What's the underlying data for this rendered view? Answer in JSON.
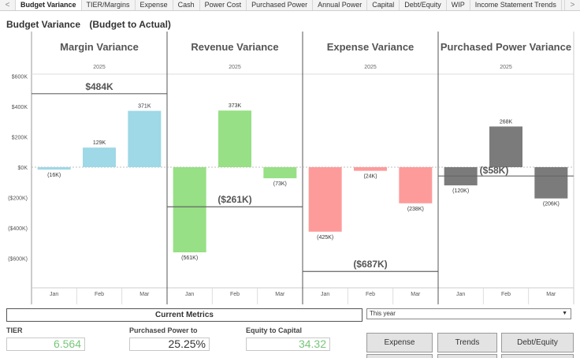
{
  "tabs": [
    "Budget Variance",
    "TIER/Margins",
    "Expense",
    "Cash",
    "Power Cost",
    "Purchased Power",
    "Annual Power",
    "Capital",
    "Debt/Equity",
    "WIP",
    "Income Statement Trends"
  ],
  "active_tab": "Budget Variance",
  "nav": {
    "prev": "<",
    "next": ">"
  },
  "dashboard": {
    "title": "Budget Variance",
    "subtitle": "(Budget to Actual)"
  },
  "chart_data": {
    "type": "bar",
    "year": "2025",
    "categories": [
      "Jan",
      "Feb",
      "Mar"
    ],
    "y_ticks": [
      "$600K",
      "$400K",
      "$200K",
      "$0K",
      "($200K)",
      "($400K)",
      "($600K)"
    ],
    "ylim": [
      -600,
      600
    ],
    "grid": false,
    "panels": [
      {
        "title": "Margin Variance",
        "values": [
          -16,
          129,
          371
        ],
        "labels": [
          "(16K)",
          "129K",
          "371K"
        ],
        "color": "#9fd8e6",
        "total": 484,
        "total_label": "$484K"
      },
      {
        "title": "Revenue Variance",
        "values": [
          -561,
          373,
          -73
        ],
        "labels": [
          "(561K)",
          "373K",
          "(73K)"
        ],
        "color": "#97e085",
        "total": -261,
        "total_label": "($261K)"
      },
      {
        "title": "Expense Variance",
        "values": [
          -425,
          -24,
          -238
        ],
        "labels": [
          "(425K)",
          "(24K)",
          "(238K)"
        ],
        "color": "#fd9b9b",
        "total": -687,
        "total_label": "($687K)"
      },
      {
        "title": "Purchased Power Variance",
        "values": [
          -120,
          268,
          -206
        ],
        "labels": [
          "(120K)",
          "268K",
          "(206K)"
        ],
        "color": "#7b7b7b",
        "total": -58,
        "total_label": "($58K)"
      }
    ]
  },
  "metrics": {
    "header": "Current Metrics",
    "tier_label": "TIER",
    "tier_value": "6.564",
    "pp_label": "Purchased Power to",
    "pp_value": "25.25%",
    "equity_label": "Equity to Capital",
    "equity_value": "34.32",
    "green": "#78c67a"
  },
  "filter": {
    "selected": "This year"
  },
  "buttons": [
    "Expense",
    "Trends",
    "Debt/Equity"
  ]
}
